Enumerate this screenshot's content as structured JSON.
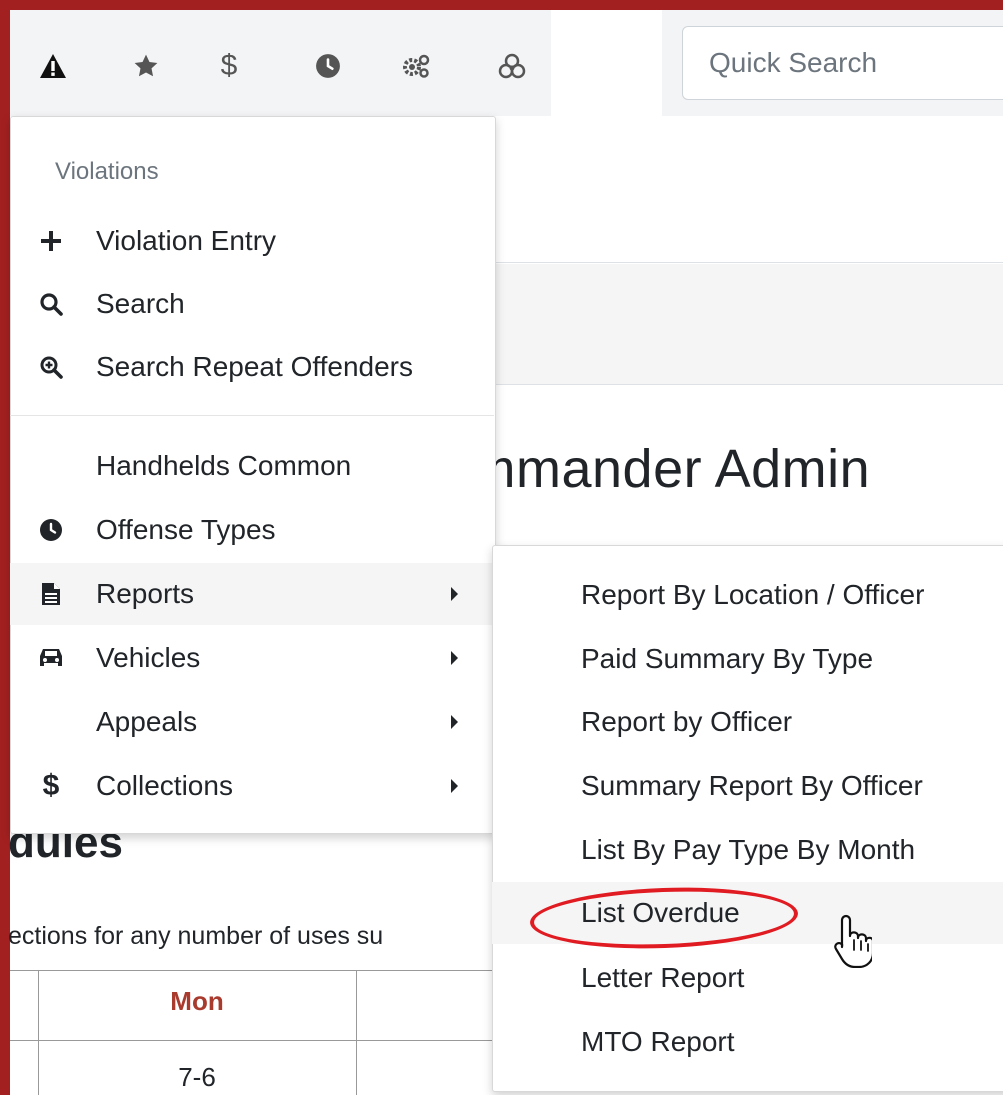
{
  "toolbar": {
    "icons": [
      "warning-icon",
      "star-icon",
      "dollar-icon",
      "clock-icon",
      "gears-icon",
      "biohazard-icon"
    ]
  },
  "search": {
    "placeholder": "Quick Search"
  },
  "page": {
    "heading": "ommander Admin",
    "subheading": "dules",
    "body_text": "ections for any number of uses su",
    "table": {
      "header": "Mon",
      "cell": "7-6"
    }
  },
  "menu": {
    "header": "Violations",
    "items": [
      {
        "label": "Violation Entry",
        "icon": "plus-icon"
      },
      {
        "label": "Search",
        "icon": "search-icon"
      },
      {
        "label": "Search Repeat Offenders",
        "icon": "search-plus-icon"
      },
      {
        "label": "Handhelds Common",
        "icon": ""
      },
      {
        "label": "Offense Types",
        "icon": "clock-icon"
      },
      {
        "label": "Reports",
        "icon": "file-icon",
        "submenu": true
      },
      {
        "label": "Vehicles",
        "icon": "car-icon",
        "submenu": true
      },
      {
        "label": "Appeals",
        "icon": "",
        "submenu": true
      },
      {
        "label": "Collections",
        "icon": "dollar-icon",
        "submenu": true
      }
    ]
  },
  "submenu": {
    "items": [
      "Report By Location / Officer",
      "Paid Summary By Type",
      "Report by Officer",
      "Summary Report By Officer",
      "List By Pay Type By Month",
      "List Overdue",
      "Letter Report",
      "MTO Report"
    ],
    "highlighted": "List Overdue"
  },
  "colors": {
    "frame": "#a32020",
    "annotation": "#e01b22",
    "table_header": "#a83a2e"
  }
}
